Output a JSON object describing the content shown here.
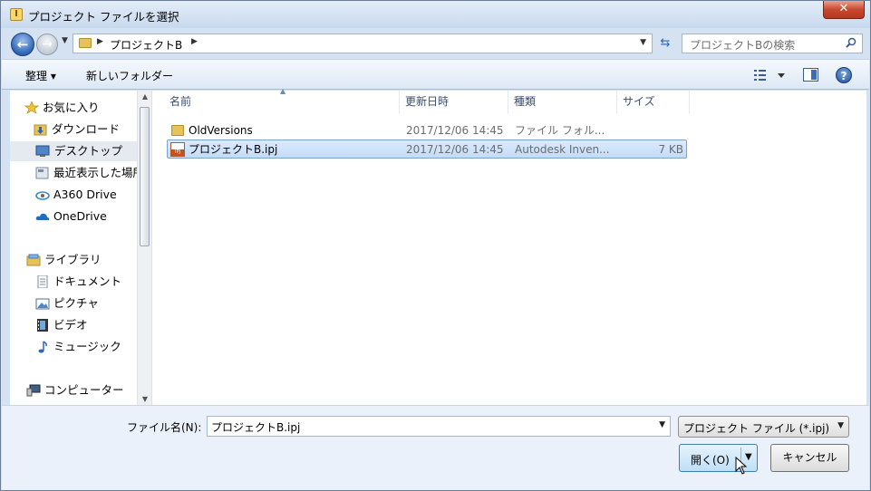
{
  "window": {
    "title": "プロジェクト ファイルを選択",
    "app_icon_letter": "I",
    "close_glyph": "✕"
  },
  "navbar": {
    "breadcrumb": "プロジェクトB",
    "search_placeholder": "プロジェクトBの検索"
  },
  "toolbar": {
    "organize_label": "整理 ▾",
    "new_folder_label": "新しいフォルダー",
    "help_glyph": "?"
  },
  "sidebar": {
    "items": [
      {
        "label": "お気に入り",
        "icon": "star-icon"
      },
      {
        "label": "ダウンロード",
        "icon": "download-folder-icon"
      },
      {
        "label": "デスクトップ",
        "icon": "desktop-icon"
      },
      {
        "label": "最近表示した場所",
        "icon": "recent-places-icon"
      },
      {
        "label": "A360 Drive",
        "icon": "a360-drive-icon"
      },
      {
        "label": "OneDrive",
        "icon": "onedrive-cloud-icon"
      },
      {
        "label": "ライブラリ",
        "icon": "library-icon"
      },
      {
        "label": "ドキュメント",
        "icon": "document-icon"
      },
      {
        "label": "ピクチャ",
        "icon": "picture-icon"
      },
      {
        "label": "ビデオ",
        "icon": "video-icon"
      },
      {
        "label": "ミュージック",
        "icon": "music-icon"
      },
      {
        "label": "コンピューター",
        "icon": "computer-icon"
      }
    ]
  },
  "files": {
    "columns": [
      "名前",
      "更新日時",
      "種類",
      "サイズ"
    ],
    "rows": [
      {
        "name": "OldVersions",
        "date": "2017/12/06 14:45",
        "type": "ファイル フォル...",
        "size": "",
        "icon": "folder-icon"
      },
      {
        "name": "プロジェクトB.ipj",
        "date": "2017/12/06 14:45",
        "type": "Autodesk Inven...",
        "size": "7 KB",
        "icon": "ipj-file-icon"
      }
    ]
  },
  "footer": {
    "filename_label": "ファイル名(N):",
    "filename_value": "プロジェクトB.ipj",
    "filter_value": "プロジェクト ファイル (*.ipj)",
    "open_label": "開く(O)",
    "cancel_label": "キャンセル"
  },
  "colors": {
    "accent": "#2d64b7",
    "selection": "#c1dcfa"
  }
}
